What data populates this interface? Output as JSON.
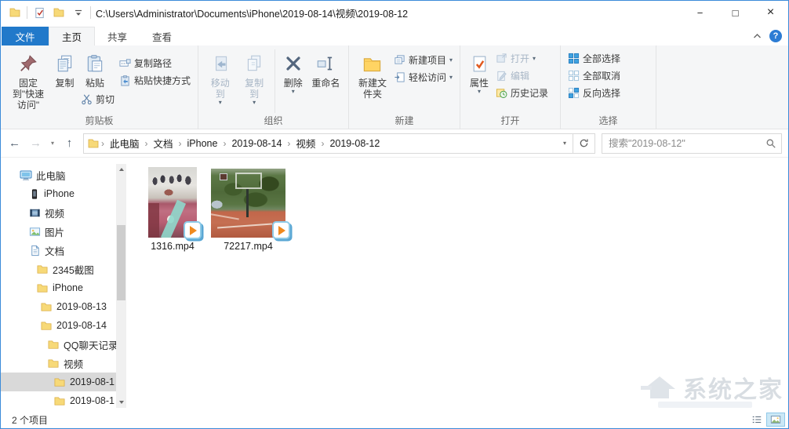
{
  "titlebar": {
    "path": "C:\\Users\\Administrator\\Documents\\iPhone\\2019-08-14\\视频\\2019-08-12"
  },
  "glyphs": {
    "min": "−",
    "max": "□",
    "close": "×",
    "help": "?",
    "dd": "▾",
    "back": "←",
    "fwd": "→",
    "up": "↑",
    "sep": "›"
  },
  "tabs": {
    "file": "文件",
    "home": "主页",
    "share": "共享",
    "view": "查看"
  },
  "ribbon": {
    "groups": {
      "clipboard": "剪贴板",
      "organize": "组织",
      "new": "新建",
      "open": "打开",
      "select": "选择"
    },
    "pin": "固定到\"快速访问\"",
    "copy": "复制",
    "paste": "粘贴",
    "cut": "剪切",
    "copy_path": "复制路径",
    "paste_shortcut": "粘贴快捷方式",
    "move_to": "移动到",
    "copy_to": "复制到",
    "delete": "删除",
    "rename": "重命名",
    "new_folder": "新建文件夹",
    "new_item": "新建项目",
    "easy_access": "轻松访问",
    "properties": "属性",
    "open_btn": "打开",
    "edit": "编辑",
    "history": "历史记录",
    "select_all": "全部选择",
    "select_none": "全部取消",
    "invert": "反向选择"
  },
  "address": {
    "breadcrumbs": [
      "此电脑",
      "文档",
      "iPhone",
      "2019-08-14",
      "视频",
      "2019-08-12"
    ]
  },
  "search": {
    "placeholder": "搜索\"2019-08-12\""
  },
  "sidebar": {
    "items": [
      {
        "label": "此电脑"
      },
      {
        "label": "iPhone"
      },
      {
        "label": "视频"
      },
      {
        "label": "图片"
      },
      {
        "label": "文档"
      },
      {
        "label": "2345截图"
      },
      {
        "label": "iPhone"
      },
      {
        "label": "2019-08-13"
      },
      {
        "label": "2019-08-14"
      },
      {
        "label": "QQ聊天记录"
      },
      {
        "label": "视频"
      },
      {
        "label": "2019-08-1"
      },
      {
        "label": "2019-08-1"
      }
    ]
  },
  "files": [
    {
      "name": "1316.mp4"
    },
    {
      "name": "72217.mp4"
    }
  ],
  "statusbar": {
    "count": "2 个项目"
  },
  "watermark": {
    "text": "系统之家"
  }
}
